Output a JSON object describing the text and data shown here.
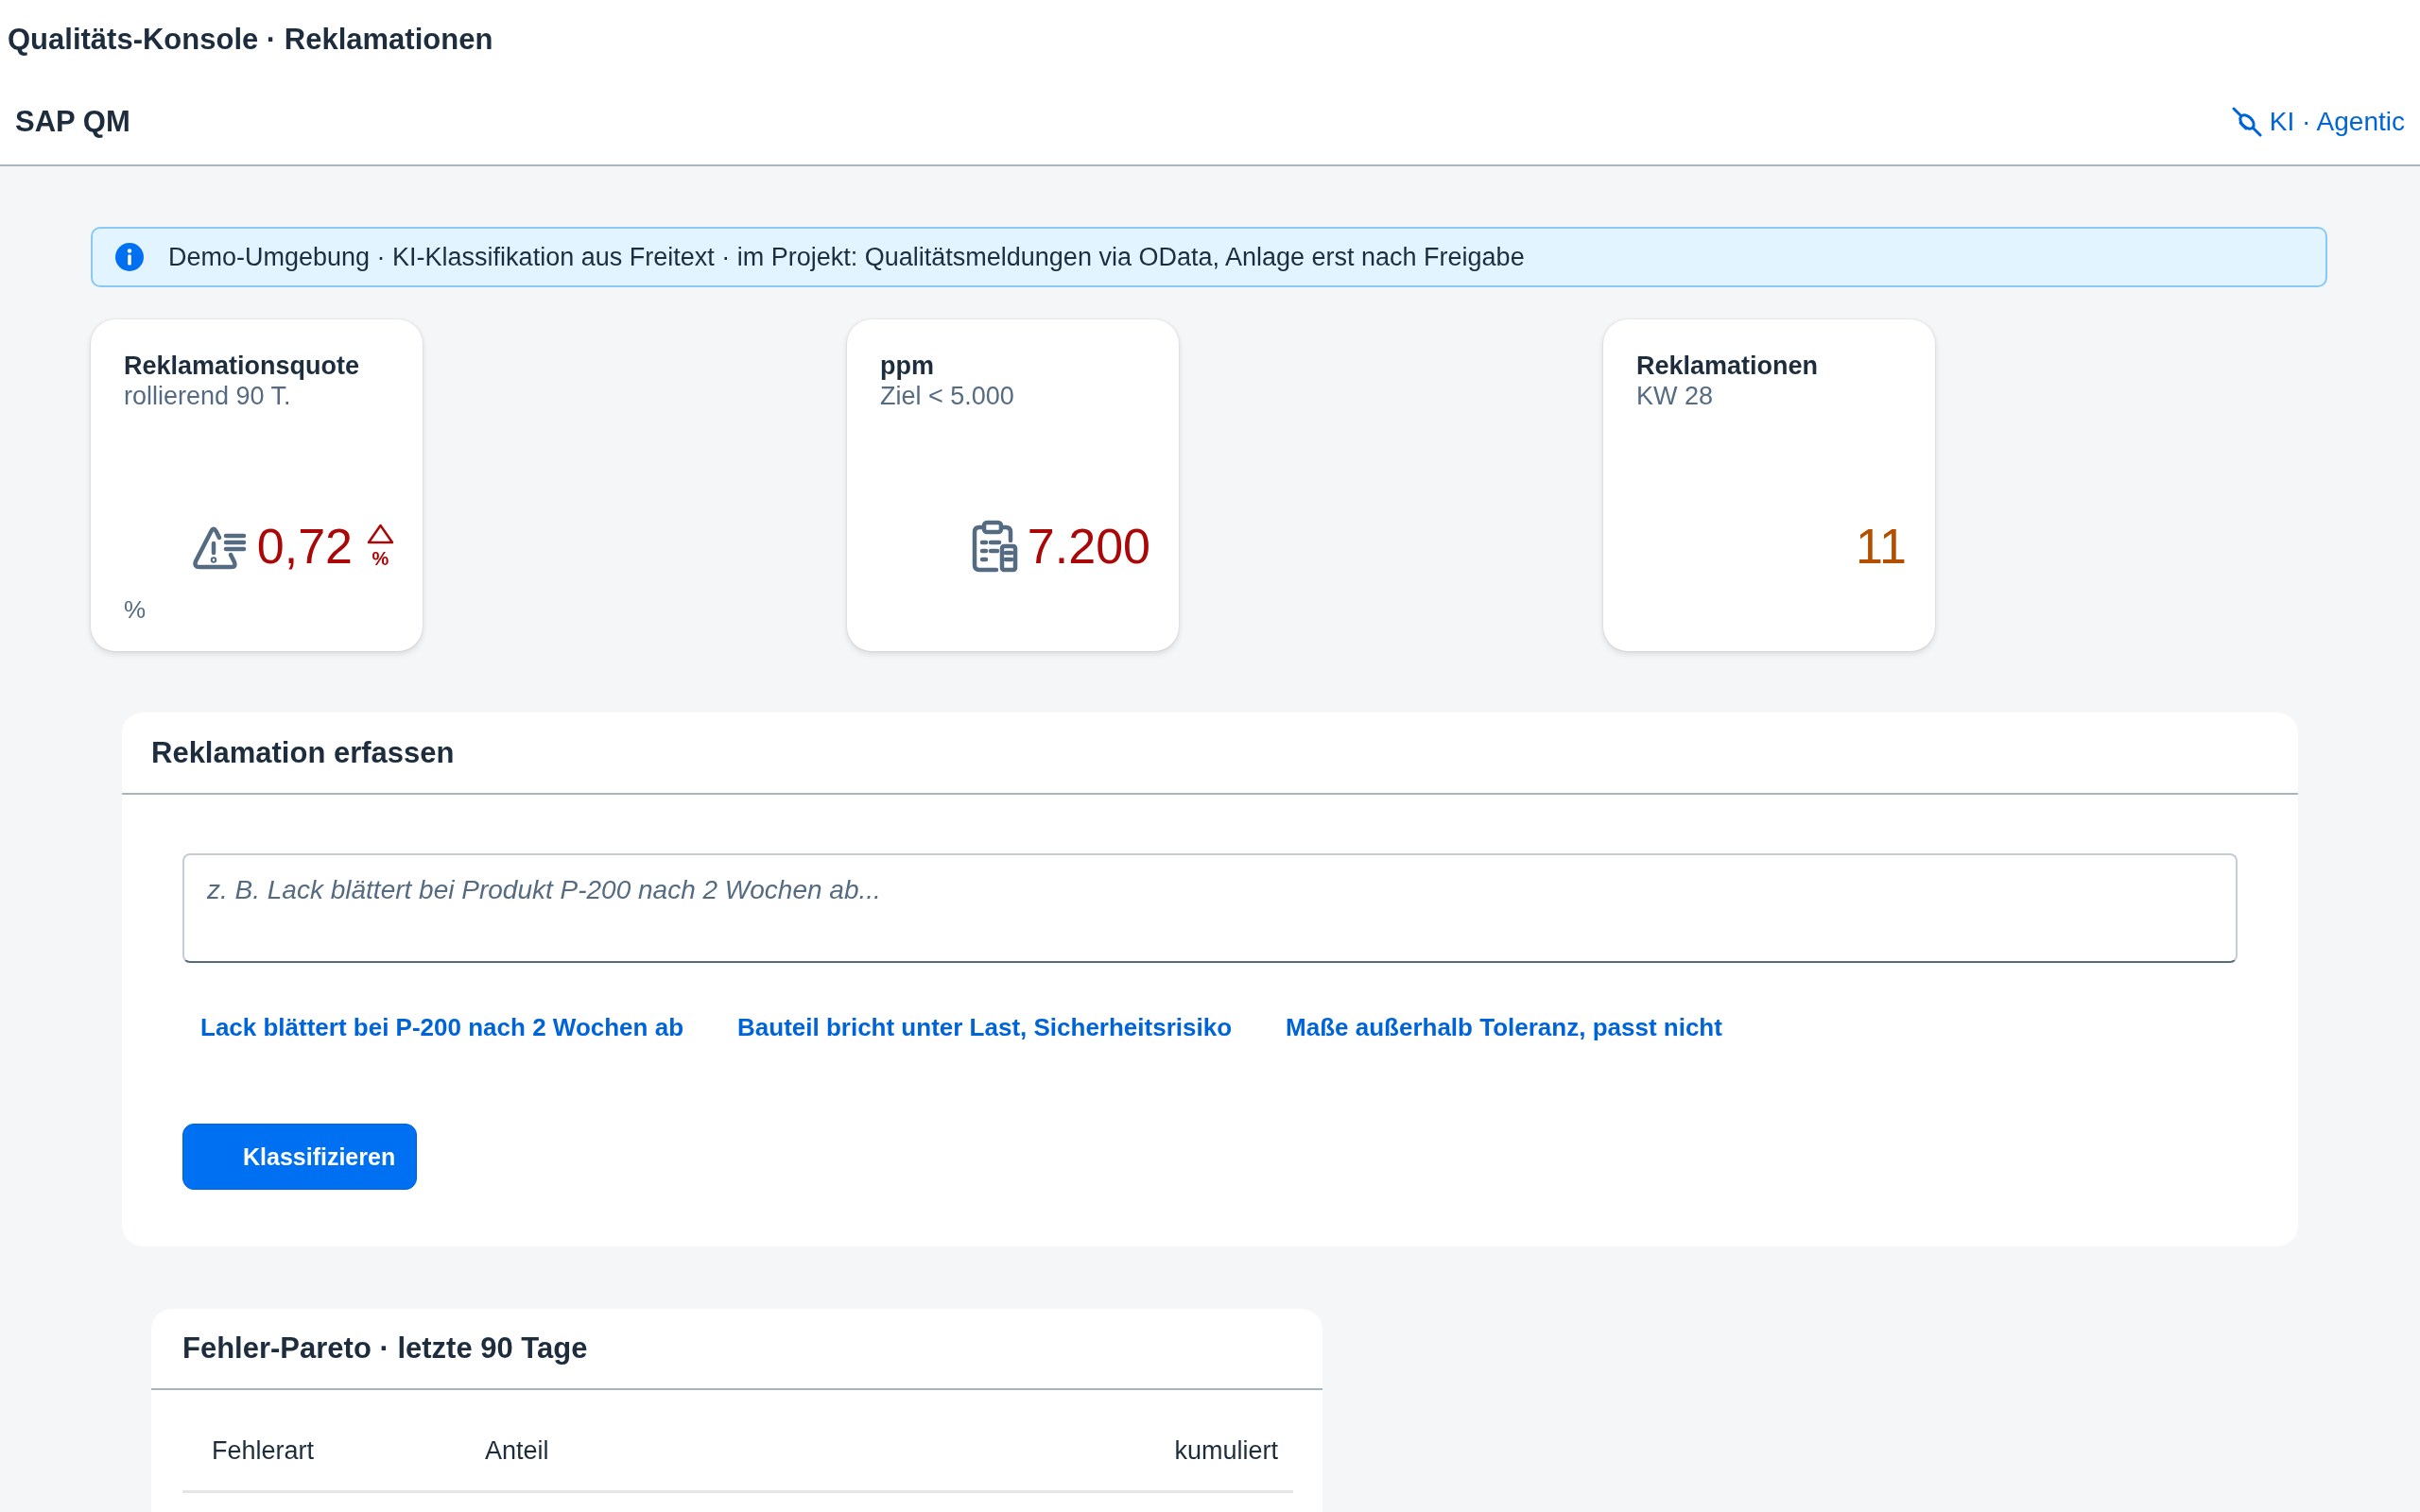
{
  "page": {
    "title": "Qualitäts-Konsole · Reklamationen"
  },
  "shell_bar": {
    "title": "SAP QM",
    "link": "KI · Agentic"
  },
  "info_strip": {
    "text": "Demo-Umgebung · KI-Klassifikation aus Freitext · im Projekt: Qualitätsmeldungen via OData, Anlage erst nach Freigabe"
  },
  "kpis": [
    {
      "kind": "rate",
      "title": "Reklamationsquote",
      "subtitle": "rollierend 90 T.",
      "value": "0,72",
      "color": "#aa0808",
      "trend_up": true,
      "scale": "%",
      "unit": "%"
    },
    {
      "kind": "ppm",
      "title": "ppm",
      "subtitle": "Ziel < 5.000",
      "value": "7.200",
      "color": "#aa0808",
      "trend_up": false
    },
    {
      "kind": "count",
      "title": "Reklamationen",
      "subtitle": "KW 28",
      "value": "11",
      "color": "#b44f00",
      "trend_up": false
    }
  ],
  "complaint_form": {
    "title": "Reklamation erfassen",
    "description": {
      "placeholder": "z. B. Lack blättert bei Produkt P-200 nach 2 Wochen ab..."
    },
    "examples": [
      "Lack blättert bei P-200 nach 2 Wochen ab",
      "Bauteil bricht unter Last, Sicherheitsrisiko",
      "Maße außerhalb Toleranz, passt nicht"
    ],
    "submit_button": "Klassifizieren"
  },
  "pareto": {
    "title": "Fehler-Pareto · letzte 90 Tage",
    "table": {
      "columns": [
        "Fehlerart",
        "Anteil",
        "kumuliert"
      ]
    }
  }
}
